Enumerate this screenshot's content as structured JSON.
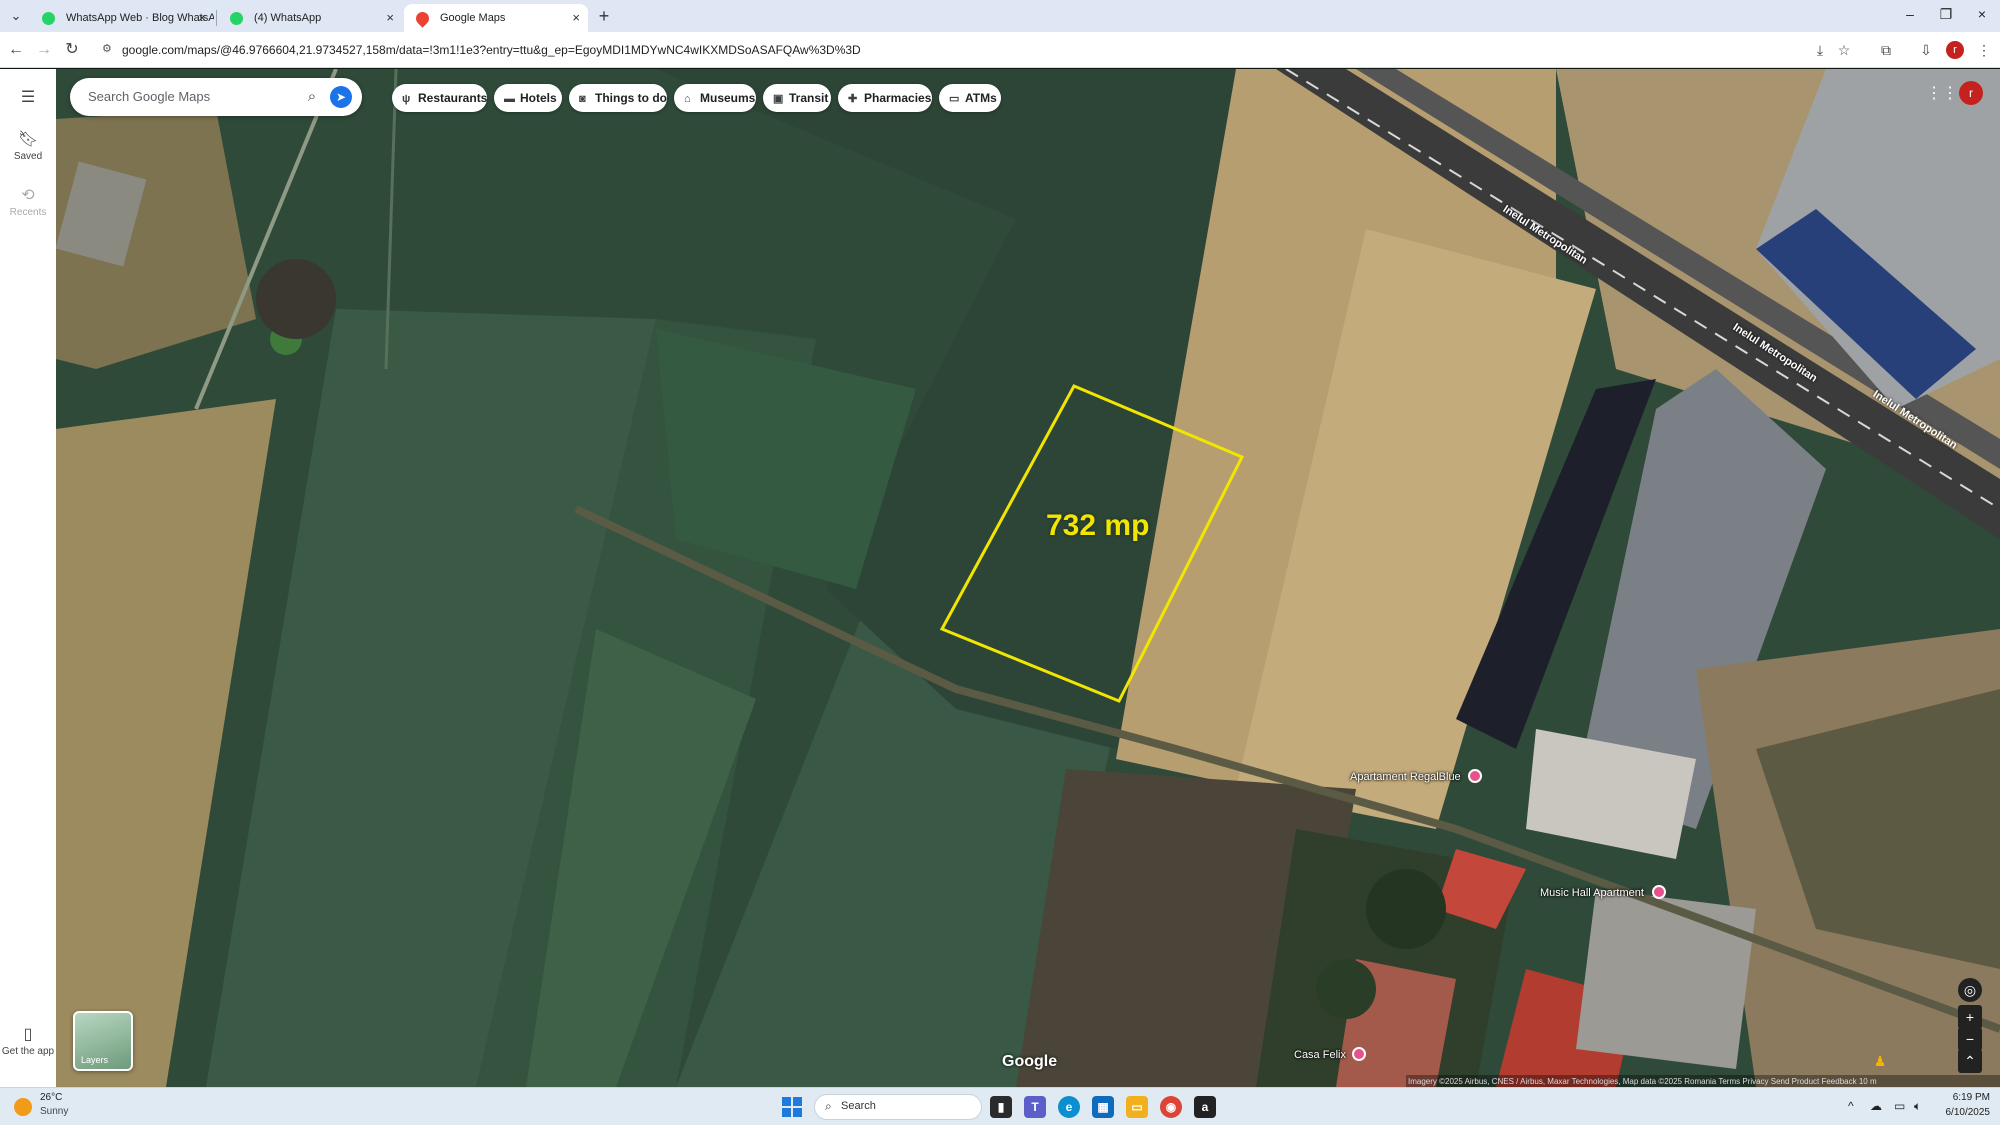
{
  "browser": {
    "tabs": [
      {
        "title": "WhatsApp Web · Blog WhatsAp",
        "icon": "whatsapp-icon"
      },
      {
        "title": "(4) WhatsApp",
        "icon": "whatsapp-icon"
      },
      {
        "title": "Google Maps",
        "icon": "maps-pin-icon"
      }
    ],
    "url": "google.com/maps/@46.9766604,21.9734527,158m/data=!3m1!1e3?entry=ttu&g_ep=EgoyMDI1MDYwNC4wIKXMDSoASAFQAw%3D%3D",
    "profile_initial": "r"
  },
  "maps": {
    "search_placeholder": "Search Google Maps",
    "rail": {
      "saved": "Saved",
      "recents": "Recents",
      "get_app": "Get the app"
    },
    "chips": [
      "Restaurants",
      "Hotels",
      "Things to do",
      "Museums",
      "Transit",
      "Pharmacies",
      "ATMs"
    ],
    "area_label": "732 mp",
    "road_labels": [
      "Inelul Metropolitan",
      "Inelul Metropolitan",
      "Inelul Metropolitan"
    ],
    "pois": [
      "Apartament RegalBlue",
      "Music Hall Apartment",
      "Casa Felix"
    ],
    "layers_label": "Layers",
    "google_logo": "Google",
    "attribution": "Imagery ©2025 Airbus, CNES / Airbus, Maxar Technologies, Map data ©2025   Romania   Terms   Privacy   Send Product Feedback   10 m",
    "profile_initial": "r"
  },
  "taskbar": {
    "weather_temp": "26°C",
    "weather_desc": "Sunny",
    "search_label": "Search",
    "time": "6:19 PM",
    "date": "6/10/2025"
  },
  "colors": {
    "outline": "#f2e600",
    "accent": "#1a73e8",
    "poi": "#e8518e"
  }
}
